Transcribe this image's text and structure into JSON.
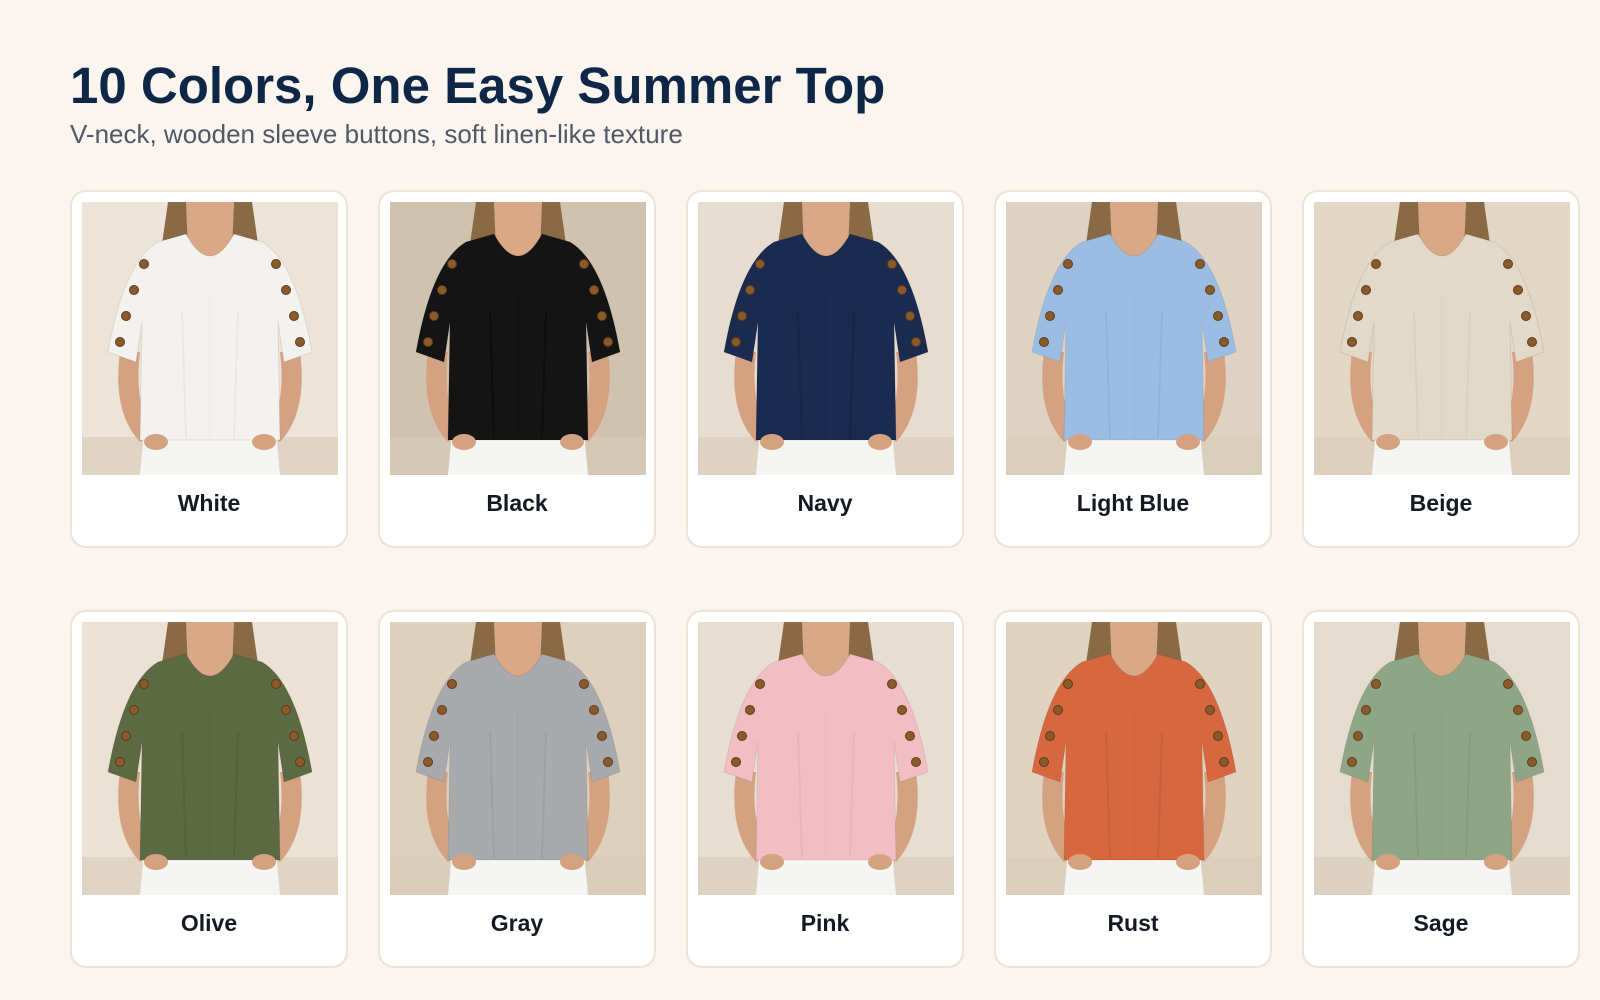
{
  "header": {
    "title": "10 Colors, One Easy Summer Top",
    "subtitle": "V-neck, wooden sleeve buttons, soft linen-like texture"
  },
  "products": [
    {
      "label": "White",
      "color": "#f4f2ee",
      "bg": "#ece4d8",
      "fold": "#dcd8d1"
    },
    {
      "label": "Black",
      "color": "#141414",
      "bg": "#cfc2af",
      "fold": "#000000"
    },
    {
      "label": "Navy",
      "color": "#1b2a4f",
      "bg": "#e6ddd0",
      "fold": "#0f1a36"
    },
    {
      "label": "Light Blue",
      "color": "#9cbde3",
      "bg": "#ddd2c3",
      "fold": "#7fa4cf"
    },
    {
      "label": "Beige",
      "color": "#e3d9c8",
      "bg": "#e3d7c6",
      "fold": "#cfc3b0"
    },
    {
      "label": "Olive",
      "color": "#5c6a43",
      "bg": "#ebe1d4",
      "fold": "#47532f"
    },
    {
      "label": "Gray",
      "color": "#a7a9ad",
      "bg": "#ddd0bd",
      "fold": "#8c8e93"
    },
    {
      "label": "Pink",
      "color": "#f2bdc3",
      "bg": "#e7ded2",
      "fold": "#e3a3ab"
    },
    {
      "label": "Rust",
      "color": "#d7673f",
      "bg": "#e0d3c0",
      "fold": "#b9502c"
    },
    {
      "label": "Sage",
      "color": "#8fa686",
      "bg": "#e4dccf",
      "fold": "#778f6e"
    }
  ]
}
